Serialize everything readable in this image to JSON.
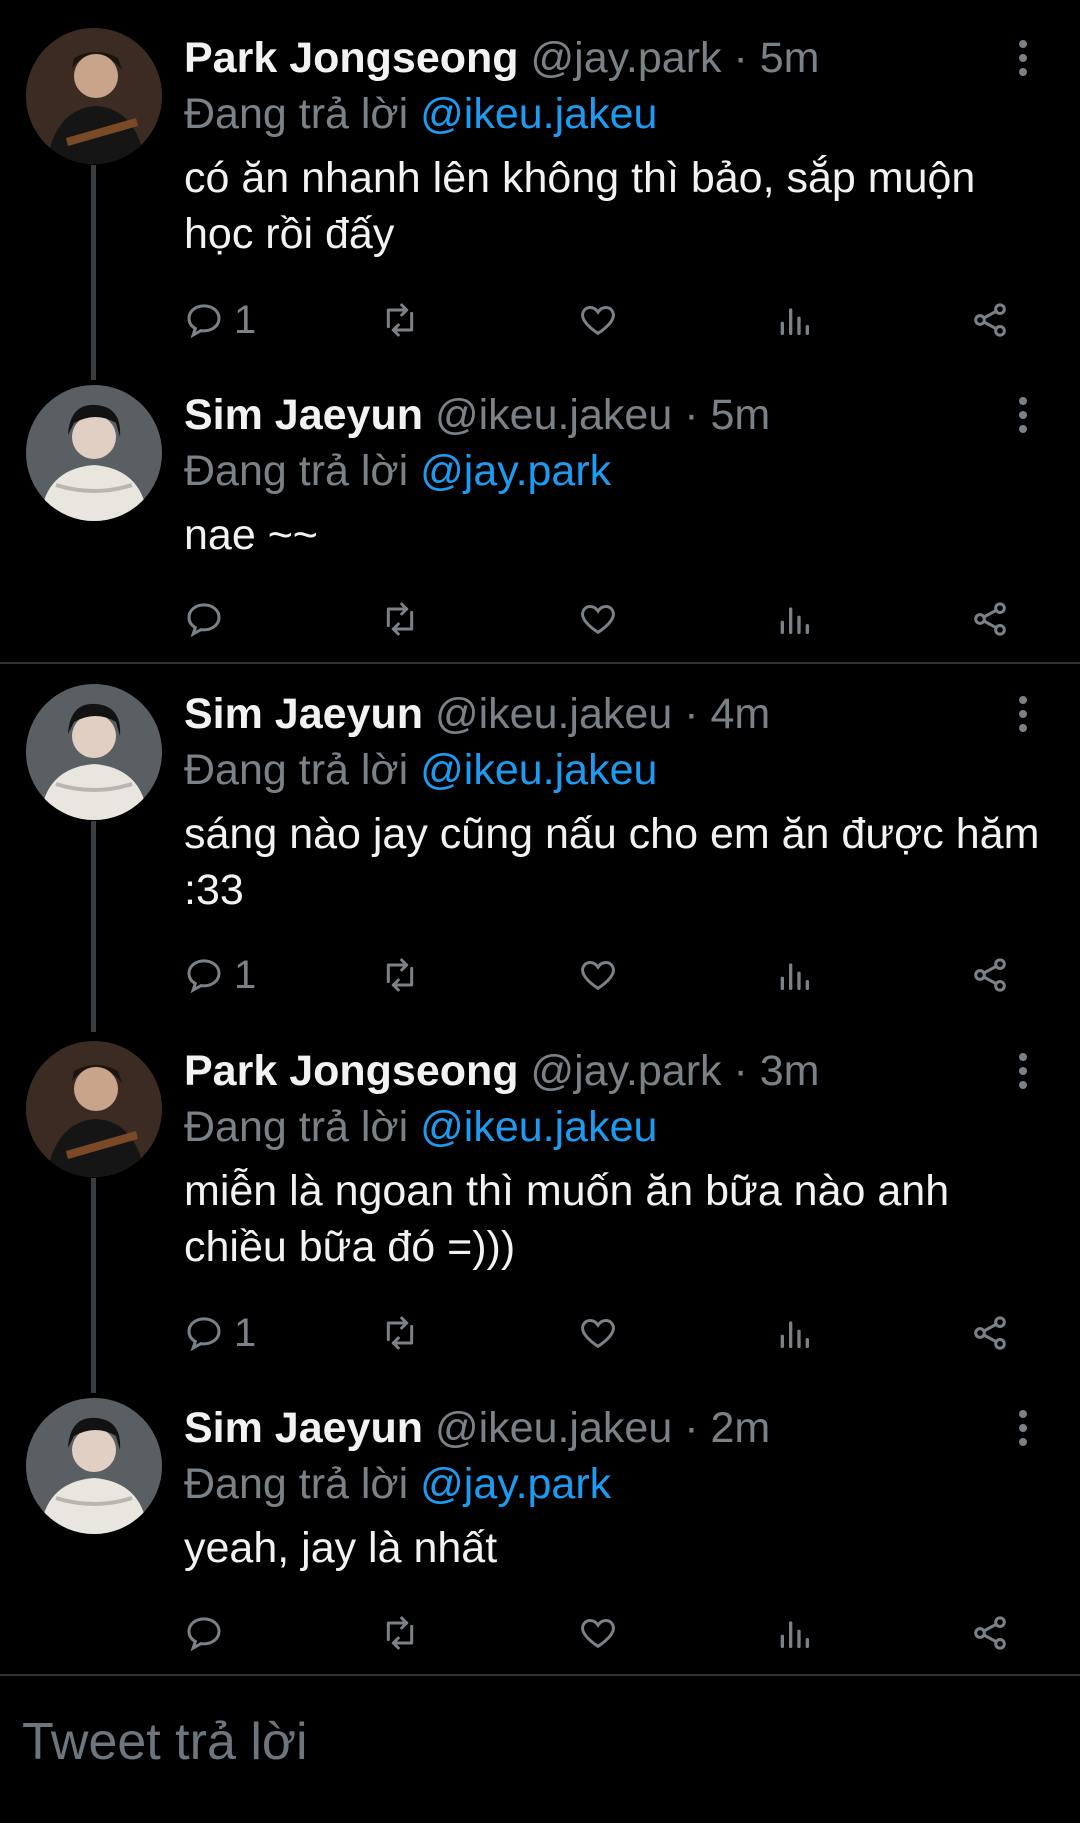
{
  "tweets": [
    {
      "author": "Park Jongseong",
      "handle": "@jay.park",
      "time": "5m",
      "reply_prefix": "Đang trả lời",
      "reply_to": "@ikeu.jakeu",
      "text": "có ăn nhanh lên không thì bảo, sắp muộn học rồi đấy",
      "reply_count": "1",
      "avatar": "avatar-jay"
    },
    {
      "author": "Sim Jaeyun",
      "handle": "@ikeu.jakeu",
      "time": "5m",
      "reply_prefix": "Đang trả lời",
      "reply_to": "@jay.park",
      "text": "nae ~~",
      "reply_count": "",
      "avatar": "avatar-jake"
    },
    {
      "author": "Sim Jaeyun",
      "handle": "@ikeu.jakeu",
      "time": "4m",
      "reply_prefix": "Đang trả lời",
      "reply_to": "@ikeu.jakeu",
      "text": "sáng nào jay cũng nấu cho em ăn được hăm :33",
      "reply_count": "1",
      "avatar": "avatar-jake"
    },
    {
      "author": "Park Jongseong",
      "handle": "@jay.park",
      "time": "3m",
      "reply_prefix": "Đang trả lời",
      "reply_to": "@ikeu.jakeu",
      "text": "miễn là ngoan thì muốn ăn bữa nào anh chiều bữa đó =)))",
      "reply_count": "1",
      "avatar": "avatar-jay"
    },
    {
      "author": "Sim Jaeyun",
      "handle": "@ikeu.jakeu",
      "time": "2m",
      "reply_prefix": "Đang trả lời",
      "reply_to": "@jay.park",
      "text": "yeah, jay là nhất",
      "reply_count": "",
      "avatar": "avatar-jake"
    }
  ],
  "separator": "·",
  "reply_box": {
    "placeholder": "Tweet trả lời"
  },
  "colors": {
    "background": "#000000",
    "accent": "#1d9bf0",
    "muted": "#7a8288"
  },
  "icons": [
    "reply-icon",
    "retweet-icon",
    "like-icon",
    "analytics-icon",
    "share-icon",
    "more-icon"
  ]
}
